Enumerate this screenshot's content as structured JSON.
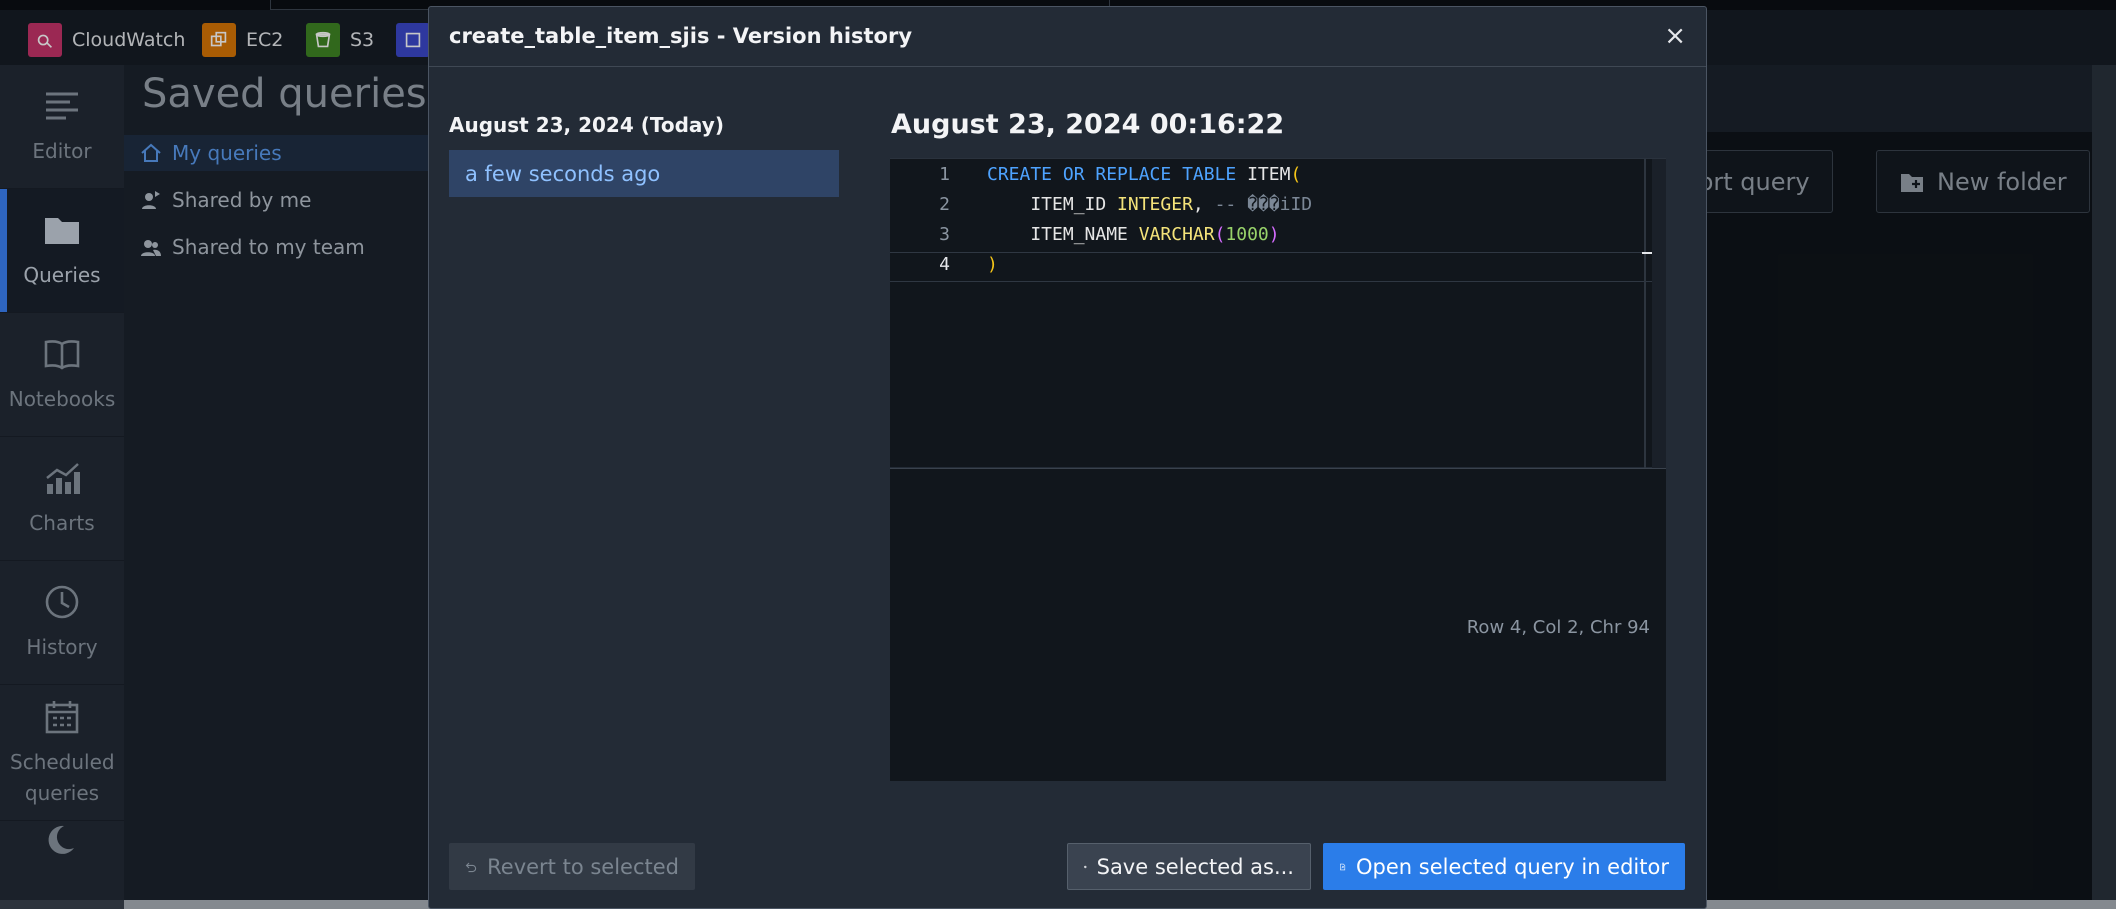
{
  "topbar": {
    "services": [
      {
        "label": "CloudWatch",
        "icon": "cloudwatch-icon",
        "color": "#c7346b"
      },
      {
        "label": "EC2",
        "icon": "ec2-icon",
        "color": "#d97706"
      },
      {
        "label": "S3",
        "icon": "s3-icon",
        "color": "#3f8624"
      },
      {
        "label": "",
        "icon": "service-icon",
        "color": "#3b48cc"
      }
    ]
  },
  "rail": {
    "items": [
      {
        "label": "Editor",
        "icon": "editor-icon"
      },
      {
        "label": "Queries",
        "icon": "folder-icon",
        "active": true
      },
      {
        "label": "Notebooks",
        "icon": "book-icon"
      },
      {
        "label": "Charts",
        "icon": "chart-icon"
      },
      {
        "label": "History",
        "icon": "clock-icon"
      },
      {
        "label": "Scheduled queries",
        "icon": "calendar-icon"
      }
    ]
  },
  "saved": {
    "title": "Saved queries",
    "items": [
      {
        "label": "My queries",
        "icon": "home-icon"
      },
      {
        "label": "Shared by me",
        "icon": "share-user-icon"
      },
      {
        "label": "Shared to my team",
        "icon": "team-icon"
      }
    ]
  },
  "background": {
    "import_label": "Import query",
    "new_folder_label": "New folder"
  },
  "modal": {
    "title": "create_table_item_sjis - Version history",
    "close_glyph": "×",
    "version_group_date": "August 23, 2024 (Today)",
    "version_item": "a few seconds ago",
    "detail_date": "August 23, 2024 00:16:22",
    "code_lines": [
      {
        "num": "1",
        "tokens": [
          {
            "t": "CREATE OR REPLACE TABLE ",
            "c": "kw"
          },
          {
            "t": "ITEM",
            "c": "id"
          },
          {
            "t": "(",
            "c": "pn"
          }
        ]
      },
      {
        "num": "2",
        "tokens": [
          {
            "t": "    ITEM_ID ",
            "c": "id"
          },
          {
            "t": "INTEGER",
            "c": "ty"
          },
          {
            "t": ", ",
            "c": "id"
          },
          {
            "t": "-- ���iID",
            "c": "cm"
          }
        ]
      },
      {
        "num": "3",
        "tokens": [
          {
            "t": "    ITEM_NAME ",
            "c": "id"
          },
          {
            "t": "VARCHAR",
            "c": "ty"
          },
          {
            "t": "(",
            "c": "pn2"
          },
          {
            "t": "1000",
            "c": "nm"
          },
          {
            "t": ")",
            "c": "pn2"
          }
        ]
      },
      {
        "num": "4",
        "tokens": [
          {
            "t": ")",
            "c": "pn"
          }
        ]
      }
    ],
    "status": "Row 4,  Col 2,  Chr 94",
    "revert_label": "Revert to selected",
    "save_label": "Save selected as...",
    "open_label": "Open selected query in editor"
  }
}
